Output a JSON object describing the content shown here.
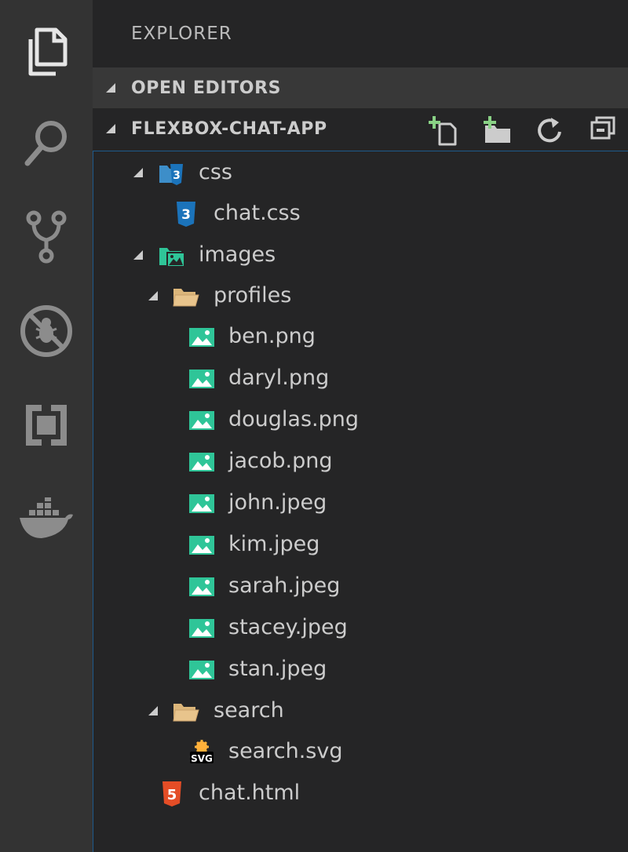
{
  "sidebar": {
    "title": "EXPLORER",
    "sections": {
      "open_editors": "OPEN EDITORS",
      "project": "FLEXBOX-CHAT-APP"
    }
  },
  "activity_bar": {
    "icons": [
      "files-icon",
      "search-icon",
      "source-control-icon",
      "debug-icon",
      "extensions-icon",
      "docker-icon"
    ]
  },
  "header_actions": [
    "new-file-icon",
    "new-folder-icon",
    "refresh-icon",
    "collapse-all-icon"
  ],
  "tree": {
    "css_folder": "css",
    "chat_css": "chat.css",
    "images_folder": "images",
    "profiles_folder": "profiles",
    "profiles": [
      "ben.png",
      "daryl.png",
      "douglas.png",
      "jacob.png",
      "john.jpeg",
      "kim.jpeg",
      "sarah.jpeg",
      "stacey.jpeg",
      "stan.jpeg"
    ],
    "search_folder": "search",
    "search_svg": "search.svg",
    "chat_html": "chat.html"
  },
  "colors": {
    "activity_bar_bg": "#333333",
    "sidebar_bg": "#252526",
    "section_header_bg": "#383838",
    "focus_border": "#1e5a8c",
    "image_icon": "#2fc598",
    "css_icon": "#1b73ba",
    "html_icon": "#e44d26",
    "folder_icon": "#dcb67a"
  }
}
